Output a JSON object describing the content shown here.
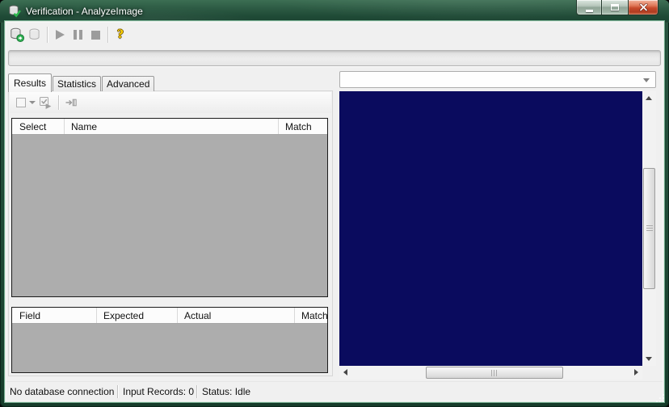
{
  "window": {
    "title": "Verification - AnalyzeImage"
  },
  "window_controls": [
    "minimize",
    "maximize",
    "close"
  ],
  "main_toolbar": {
    "buttons": [
      {
        "icon": "database-connect-icon",
        "enabled": true
      },
      {
        "icon": "database-disconnect-icon",
        "enabled": false
      },
      {
        "icon": "play-icon",
        "enabled": false
      },
      {
        "icon": "pause-icon",
        "enabled": false
      },
      {
        "icon": "stop-icon",
        "enabled": false
      },
      {
        "icon": "help-icon",
        "enabled": true
      }
    ],
    "help_glyph": "?"
  },
  "progress_bar": {
    "percent": 0
  },
  "tabs": [
    {
      "label": "Results",
      "active": true
    },
    {
      "label": "Statistics",
      "active": false
    },
    {
      "label": "Advanced",
      "active": false
    }
  ],
  "results_toolbar": {
    "buttons": [
      {
        "icon": "checkbox-dropdown-icon",
        "enabled": false
      },
      {
        "icon": "check-apply-icon",
        "enabled": false
      },
      {
        "icon": "send-to-icon",
        "enabled": false
      }
    ]
  },
  "results_table": {
    "columns": [
      "Select",
      "Name",
      "Match"
    ],
    "rows": []
  },
  "details_table": {
    "columns": [
      "Field",
      "Expected",
      "Actual",
      "Match"
    ],
    "rows": []
  },
  "image_panel": {
    "image_selector_value": "",
    "canvas_color": "#0A0B5E"
  },
  "status_bar": {
    "connection": "No database connection",
    "input_records": "Input Records: 0",
    "status": "Status: Idle"
  },
  "colors": {
    "title_bar_green": "#234F3A",
    "canvas_navy": "#0A0B5E",
    "close_button_red": "#C74A2B",
    "table_body_gray": "#ADADAD"
  }
}
